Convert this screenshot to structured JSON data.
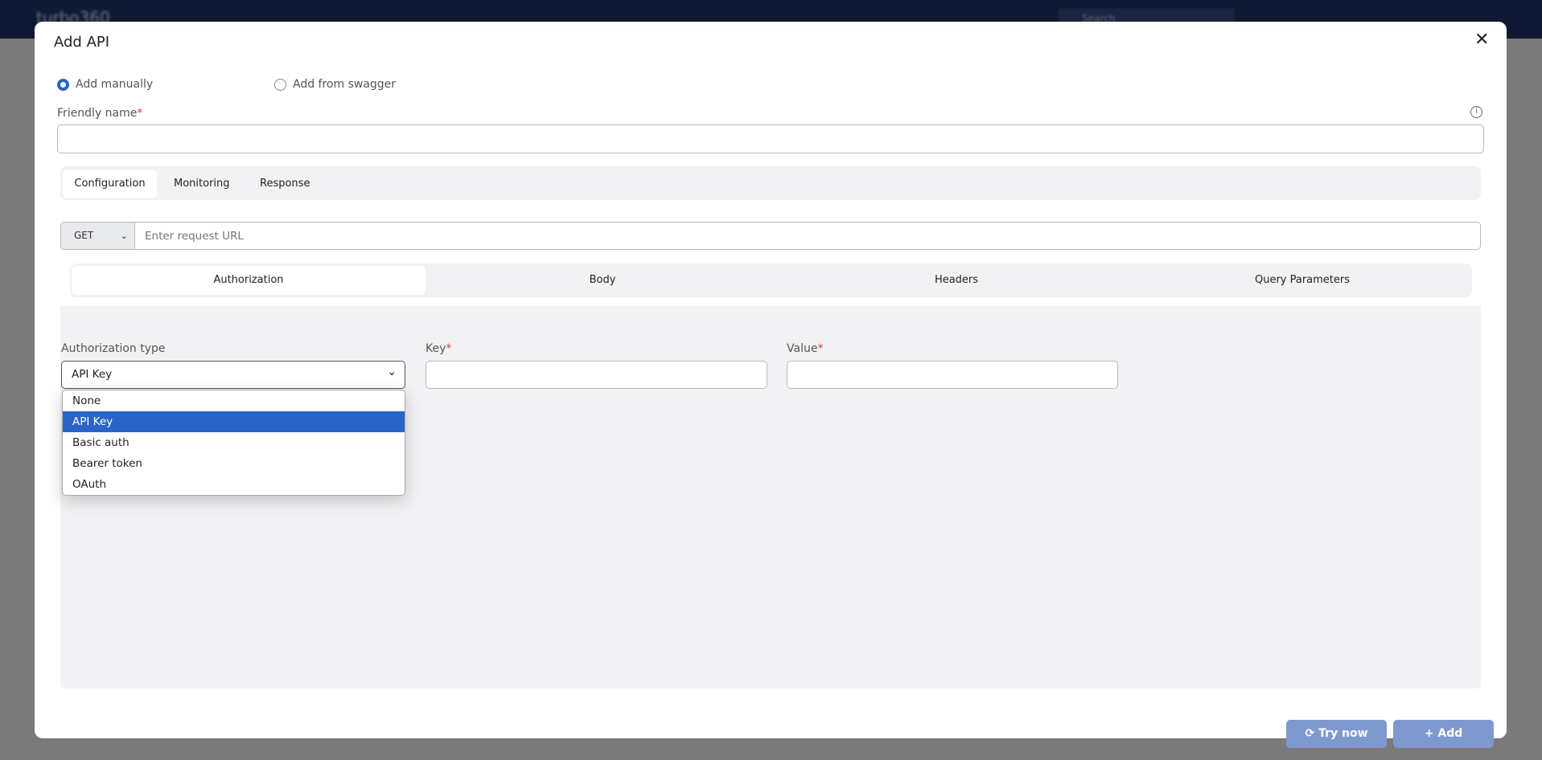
{
  "background": {
    "brand": "turbo360",
    "search_placeholder": "Search"
  },
  "modal": {
    "title": "Add API",
    "close_icon": "close-icon",
    "mode_options": [
      {
        "label": "Add manually",
        "selected": true
      },
      {
        "label": "Add from swagger",
        "selected": false
      }
    ],
    "friendly_name": {
      "label": "Friendly name",
      "required_mark": "*",
      "value": "",
      "info_icon": "info-icon"
    },
    "tabs": [
      {
        "label": "Configuration",
        "active": true
      },
      {
        "label": "Monitoring",
        "active": false
      },
      {
        "label": "Response",
        "active": false
      }
    ],
    "request": {
      "method": "GET",
      "url_placeholder": "Enter request URL",
      "url_value": ""
    },
    "subtabs": [
      {
        "label": "Authorization",
        "active": true
      },
      {
        "label": "Body",
        "active": false
      },
      {
        "label": "Headers",
        "active": false
      },
      {
        "label": "Query Parameters",
        "active": false
      }
    ],
    "auth": {
      "type_label": "Authorization type",
      "type_value": "API Key",
      "options": [
        "None",
        "API Key",
        "Basic auth",
        "Bearer token",
        "OAuth"
      ],
      "selected_option": "API Key",
      "key_label": "Key",
      "value_label": "Value",
      "required_mark": "*"
    },
    "buttons": {
      "try_now": "Try now",
      "add": "Add"
    },
    "colors": {
      "accent": "#2a64c9",
      "button": "#7e99cf",
      "required": "#e03535"
    }
  }
}
